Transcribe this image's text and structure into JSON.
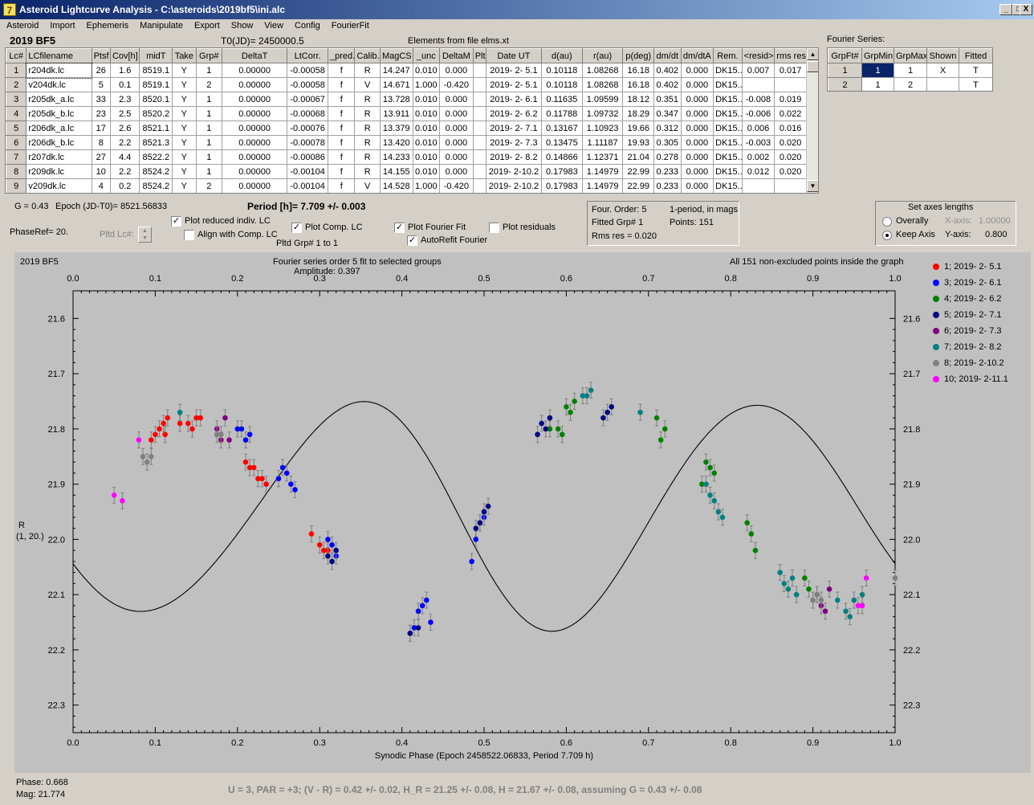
{
  "window": {
    "title": "Asteroid Lightcurve Analysis - C:\\asteroids\\2019bf5\\ini.alc",
    "app_icon": "7",
    "btn_min": "_",
    "btn_max": "□",
    "btn_close": "X"
  },
  "menu": [
    "Asteroid",
    "Import",
    "Ephemeris",
    "Manipulate",
    "Export",
    "Show",
    "View",
    "Config",
    "FourierFit"
  ],
  "header": {
    "object": "2019 BF5",
    "t0": "T0(JD)= 2450000.5",
    "elements": "Elements from file elms.xt"
  },
  "lc_table": {
    "columns": [
      "Lc#",
      "LCfilename",
      "Ptsf",
      "Cov[h]",
      "midT",
      "Take",
      "Grp#",
      "DeltaT",
      "LtCorr.",
      "_pred.",
      "Calib.",
      "MagCS",
      "_unc",
      "DeltaM",
      "Plt",
      "Date UT",
      "d(au)",
      "r(au)",
      "p(deg)",
      "dm/dt",
      "dm/dtA",
      "Rem.",
      "<resid>",
      "rms res"
    ],
    "rows": [
      [
        "1",
        "r204dk.lc",
        "26",
        "1.6",
        "8519.1",
        "Y",
        "1",
        "0.00000",
        "-0.00058",
        "f",
        "R",
        "14.247",
        "0.010",
        "0.000",
        "",
        "2019- 2- 5.1",
        "0.10118",
        "1.08268",
        "16.18",
        "0.402",
        "0.000",
        "DK15...",
        "0.007",
        "0.017"
      ],
      [
        "2",
        "v204dk.lc",
        "5",
        "0.1",
        "8519.1",
        "Y",
        "2",
        "0.00000",
        "-0.00058",
        "f",
        "V",
        "14.671",
        "1.000",
        "-0.420",
        "",
        "2019- 2- 5.1",
        "0.10118",
        "1.08268",
        "16.18",
        "0.402",
        "0.000",
        "DK15...",
        "",
        ""
      ],
      [
        "3",
        "r205dk_a.lc",
        "33",
        "2.3",
        "8520.1",
        "Y",
        "1",
        "0.00000",
        "-0.00067",
        "f",
        "R",
        "13.728",
        "0.010",
        "0.000",
        "",
        "2019- 2- 6.1",
        "0.11635",
        "1.09599",
        "18.12",
        "0.351",
        "0.000",
        "DK15...",
        "-0.008",
        "0.019"
      ],
      [
        "4",
        "r205dk_b.lc",
        "23",
        "2.5",
        "8520.2",
        "Y",
        "1",
        "0.00000",
        "-0.00068",
        "f",
        "R",
        "13.911",
        "0.010",
        "0.000",
        "",
        "2019- 2- 6.2",
        "0.11788",
        "1.09732",
        "18.29",
        "0.347",
        "0.000",
        "DK15...",
        "-0.006",
        "0.022"
      ],
      [
        "5",
        "r206dk_a.lc",
        "17",
        "2.6",
        "8521.1",
        "Y",
        "1",
        "0.00000",
        "-0.00076",
        "f",
        "R",
        "13.379",
        "0.010",
        "0.000",
        "",
        "2019- 2- 7.1",
        "0.13167",
        "1.10923",
        "19.66",
        "0.312",
        "0.000",
        "DK15...",
        "0.006",
        "0.016"
      ],
      [
        "6",
        "r206dk_b.lc",
        "8",
        "2.2",
        "8521.3",
        "Y",
        "1",
        "0.00000",
        "-0.00078",
        "f",
        "R",
        "13.420",
        "0.010",
        "0.000",
        "",
        "2019- 2- 7.3",
        "0.13475",
        "1.11187",
        "19.93",
        "0.305",
        "0.000",
        "DK15...",
        "-0.003",
        "0.020"
      ],
      [
        "7",
        "r207dk.lc",
        "27",
        "4.4",
        "8522.2",
        "Y",
        "1",
        "0.00000",
        "-0.00086",
        "f",
        "R",
        "14.233",
        "0.010",
        "0.000",
        "",
        "2019- 2- 8.2",
        "0.14866",
        "1.12371",
        "21.04",
        "0.278",
        "0.000",
        "DK15...",
        "0.002",
        "0.020"
      ],
      [
        "8",
        "r209dk.lc",
        "10",
        "2.2",
        "8524.2",
        "Y",
        "1",
        "0.00000",
        "-0.00104",
        "f",
        "R",
        "14.155",
        "0.010",
        "0.000",
        "",
        "2019- 2-10.2",
        "0.17983",
        "1.14979",
        "22.99",
        "0.233",
        "0.000",
        "DK15...",
        "0.012",
        "0.020"
      ],
      [
        "9",
        "v209dk.lc",
        "4",
        "0.2",
        "8524.2",
        "Y",
        "2",
        "0.00000",
        "-0.00104",
        "f",
        "V",
        "14.528",
        "1.000",
        "-0.420",
        "",
        "2019- 2-10.2",
        "0.17983",
        "1.14979",
        "22.99",
        "0.233",
        "0.000",
        "DK15...",
        "",
        ""
      ]
    ]
  },
  "fourier_table": {
    "title": "Fourier Series:",
    "columns": [
      "GrpFt#",
      "GrpMin",
      "GrpMax",
      "Shown",
      "Fitted"
    ],
    "rows": [
      [
        "1",
        "1",
        "1",
        "X",
        "T"
      ],
      [
        "2",
        "1",
        "2",
        "",
        "T"
      ]
    ]
  },
  "controls": {
    "g_label": "G = 0.43",
    "epoch_label": "Epoch (JD-T0)= 8521.56833",
    "period_label": "Period [h]= 7.709 +/- 0.003",
    "phaseref_label": "PhaseRef= 20.",
    "pltd_lc_label": "Pltd Lc#:",
    "plot_reduced": "Plot reduced indiv. LC",
    "align_comp": "Align with Comp. LC",
    "plot_comp": "Plot Comp. LC",
    "pltd_grp": "Pltd Grp#  1   to   1",
    "plot_fourier": "Plot Fourier Fit",
    "autorefit": "AutoRefit Fourier",
    "plot_residuals": "Plot residuals",
    "check_mark": "✓"
  },
  "fit_info": {
    "order": "Four. Order:  5",
    "period_mode": "1-period, in mags",
    "fitted_grp": "Fitted Grp# 1",
    "points": "Points: 151",
    "rms": "Rms res      = 0.020"
  },
  "axes_box": {
    "title": "Set axes lengths",
    "overally": "Overally",
    "keep_axis": "Keep Axis",
    "x_label": "X-axis:",
    "x_value": "1.00000",
    "y_label": "Y-axis:",
    "y_value": "0.800"
  },
  "plot": {
    "object": "2019 BF5",
    "fit_title": "Fourier series order 5 fit to selected groups",
    "amplitude": "Amplitude: 0.397",
    "points_note": "All 151 non-excluded points inside the graph",
    "y_axis_label_1": "R",
    "y_axis_label_2": "(1, 20.)"
  },
  "footer": {
    "phase": "Phase:  0.668",
    "mag": "Mag:    21.774",
    "summary": "U = 3, PAR = +3; (V - R) = 0.42 +/- 0.02, H_R = 21.25 +/- 0.08, H = 21.67 +/- 0.08, assuming G = 0.43 +/- 0.08"
  },
  "chart_data": {
    "type": "scatter",
    "xlabel": "Synodic Phase (Epoch 2458522.06833, Period 7.709 h)",
    "ylabel": "R (1, 20.)",
    "xlim": [
      0.0,
      1.0
    ],
    "ylim": [
      22.35,
      21.55
    ],
    "y_inverted": true,
    "grid": false,
    "legend_placement": "right",
    "x_ticks": [
      "0.0",
      "0.1",
      "0.2",
      "0.3",
      "0.4",
      "0.5",
      "0.6",
      "0.7",
      "0.8",
      "0.9",
      "1.0"
    ],
    "y_ticks": [
      "21.6",
      "21.7",
      "21.8",
      "21.9",
      "22.0",
      "22.1",
      "22.2",
      "22.3"
    ],
    "fit_curve": {
      "mean": 21.951,
      "harmonics": [
        {
          "k": 1,
          "c": 0.0,
          "s": 0.0
        },
        {
          "k": 2,
          "c": 0.088,
          "s": 0.175
        },
        {
          "k": 3,
          "c": 0.0,
          "s": -0.018
        },
        {
          "k": 4,
          "c": 0.005,
          "s": 0.005
        }
      ]
    },
    "series": [
      {
        "name": "1; 2019- 2- 5.1",
        "color": "#ff0000",
        "points": [
          [
            0.095,
            21.82
          ],
          [
            0.1,
            21.81
          ],
          [
            0.105,
            21.8
          ],
          [
            0.11,
            21.79
          ],
          [
            0.112,
            21.81
          ],
          [
            0.115,
            21.78
          ],
          [
            0.13,
            21.79
          ],
          [
            0.14,
            21.79
          ],
          [
            0.145,
            21.8
          ],
          [
            0.15,
            21.78
          ],
          [
            0.155,
            21.78
          ],
          [
            0.21,
            21.86
          ],
          [
            0.215,
            21.87
          ],
          [
            0.22,
            21.87
          ],
          [
            0.225,
            21.89
          ],
          [
            0.23,
            21.89
          ],
          [
            0.235,
            21.9
          ],
          [
            0.29,
            21.99
          ],
          [
            0.3,
            22.01
          ],
          [
            0.305,
            22.02
          ],
          [
            0.31,
            22.02
          ]
        ]
      },
      {
        "name": "3; 2019- 2- 6.1",
        "color": "#0000ff",
        "points": [
          [
            0.2,
            21.8
          ],
          [
            0.205,
            21.8
          ],
          [
            0.21,
            21.82
          ],
          [
            0.215,
            21.81
          ],
          [
            0.25,
            21.89
          ],
          [
            0.255,
            21.87
          ],
          [
            0.26,
            21.88
          ],
          [
            0.265,
            21.9
          ],
          [
            0.27,
            21.91
          ],
          [
            0.31,
            22.0
          ],
          [
            0.315,
            22.01
          ],
          [
            0.32,
            22.03
          ],
          [
            0.41,
            22.17
          ],
          [
            0.415,
            22.16
          ],
          [
            0.42,
            22.13
          ],
          [
            0.425,
            22.12
          ],
          [
            0.43,
            22.11
          ],
          [
            0.435,
            22.15
          ],
          [
            0.485,
            22.04
          ],
          [
            0.49,
            22.0
          ],
          [
            0.495,
            21.97
          ],
          [
            0.5,
            21.96
          ]
        ]
      },
      {
        "name": "4; 2019- 2- 6.2",
        "color": "#008000",
        "points": [
          [
            0.58,
            21.8
          ],
          [
            0.59,
            21.8
          ],
          [
            0.595,
            21.81
          ],
          [
            0.6,
            21.76
          ],
          [
            0.605,
            21.77
          ],
          [
            0.61,
            21.75
          ],
          [
            0.71,
            21.78
          ],
          [
            0.715,
            21.82
          ],
          [
            0.72,
            21.8
          ],
          [
            0.765,
            21.9
          ],
          [
            0.77,
            21.86
          ],
          [
            0.775,
            21.87
          ],
          [
            0.78,
            21.88
          ],
          [
            0.82,
            21.97
          ],
          [
            0.825,
            21.99
          ],
          [
            0.83,
            22.02
          ],
          [
            0.89,
            22.07
          ],
          [
            0.895,
            22.09
          ],
          [
            0.9,
            22.11
          ]
        ]
      },
      {
        "name": "5; 2019- 2- 7.1",
        "color": "#000080",
        "points": [
          [
            0.31,
            22.03
          ],
          [
            0.315,
            22.04
          ],
          [
            0.32,
            22.02
          ],
          [
            0.565,
            21.81
          ],
          [
            0.57,
            21.79
          ],
          [
            0.575,
            21.8
          ],
          [
            0.58,
            21.78
          ],
          [
            0.645,
            21.78
          ],
          [
            0.65,
            21.77
          ],
          [
            0.655,
            21.76
          ],
          [
            0.49,
            21.98
          ],
          [
            0.495,
            21.97
          ],
          [
            0.5,
            21.95
          ],
          [
            0.505,
            21.94
          ],
          [
            0.41,
            22.17
          ],
          [
            0.42,
            22.16
          ]
        ]
      },
      {
        "name": "6; 2019- 2- 7.3",
        "color": "#800080",
        "points": [
          [
            0.175,
            21.8
          ],
          [
            0.18,
            21.82
          ],
          [
            0.185,
            21.78
          ],
          [
            0.19,
            21.82
          ],
          [
            0.905,
            22.1
          ],
          [
            0.91,
            22.12
          ],
          [
            0.915,
            22.13
          ],
          [
            0.92,
            22.09
          ]
        ]
      },
      {
        "name": "7; 2019- 2- 8.2",
        "color": "#008080",
        "points": [
          [
            0.13,
            21.77
          ],
          [
            0.62,
            21.74
          ],
          [
            0.625,
            21.74
          ],
          [
            0.63,
            21.73
          ],
          [
            0.69,
            21.77
          ],
          [
            0.77,
            21.9
          ],
          [
            0.775,
            21.92
          ],
          [
            0.78,
            21.93
          ],
          [
            0.785,
            21.95
          ],
          [
            0.79,
            21.96
          ],
          [
            0.86,
            22.06
          ],
          [
            0.865,
            22.08
          ],
          [
            0.87,
            22.09
          ],
          [
            0.875,
            22.07
          ],
          [
            0.88,
            22.1
          ],
          [
            0.93,
            22.11
          ],
          [
            0.94,
            22.13
          ],
          [
            0.945,
            22.14
          ],
          [
            0.95,
            22.11
          ],
          [
            0.96,
            22.1
          ]
        ]
      },
      {
        "name": "8; 2019- 2-10.2",
        "color": "#808080",
        "points": [
          [
            0.085,
            21.85
          ],
          [
            0.09,
            21.86
          ],
          [
            0.095,
            21.85
          ],
          [
            0.175,
            21.81
          ],
          [
            0.18,
            21.81
          ],
          [
            0.9,
            22.11
          ],
          [
            0.905,
            22.1
          ],
          [
            0.91,
            22.11
          ],
          [
            1.0,
            22.07
          ]
        ]
      },
      {
        "name": "10; 2019- 2-11.1",
        "color": "#ff00ff",
        "points": [
          [
            0.05,
            21.92
          ],
          [
            0.06,
            21.93
          ],
          [
            0.08,
            21.82
          ],
          [
            0.955,
            22.12
          ],
          [
            0.96,
            22.12
          ],
          [
            0.965,
            22.07
          ]
        ]
      }
    ]
  }
}
